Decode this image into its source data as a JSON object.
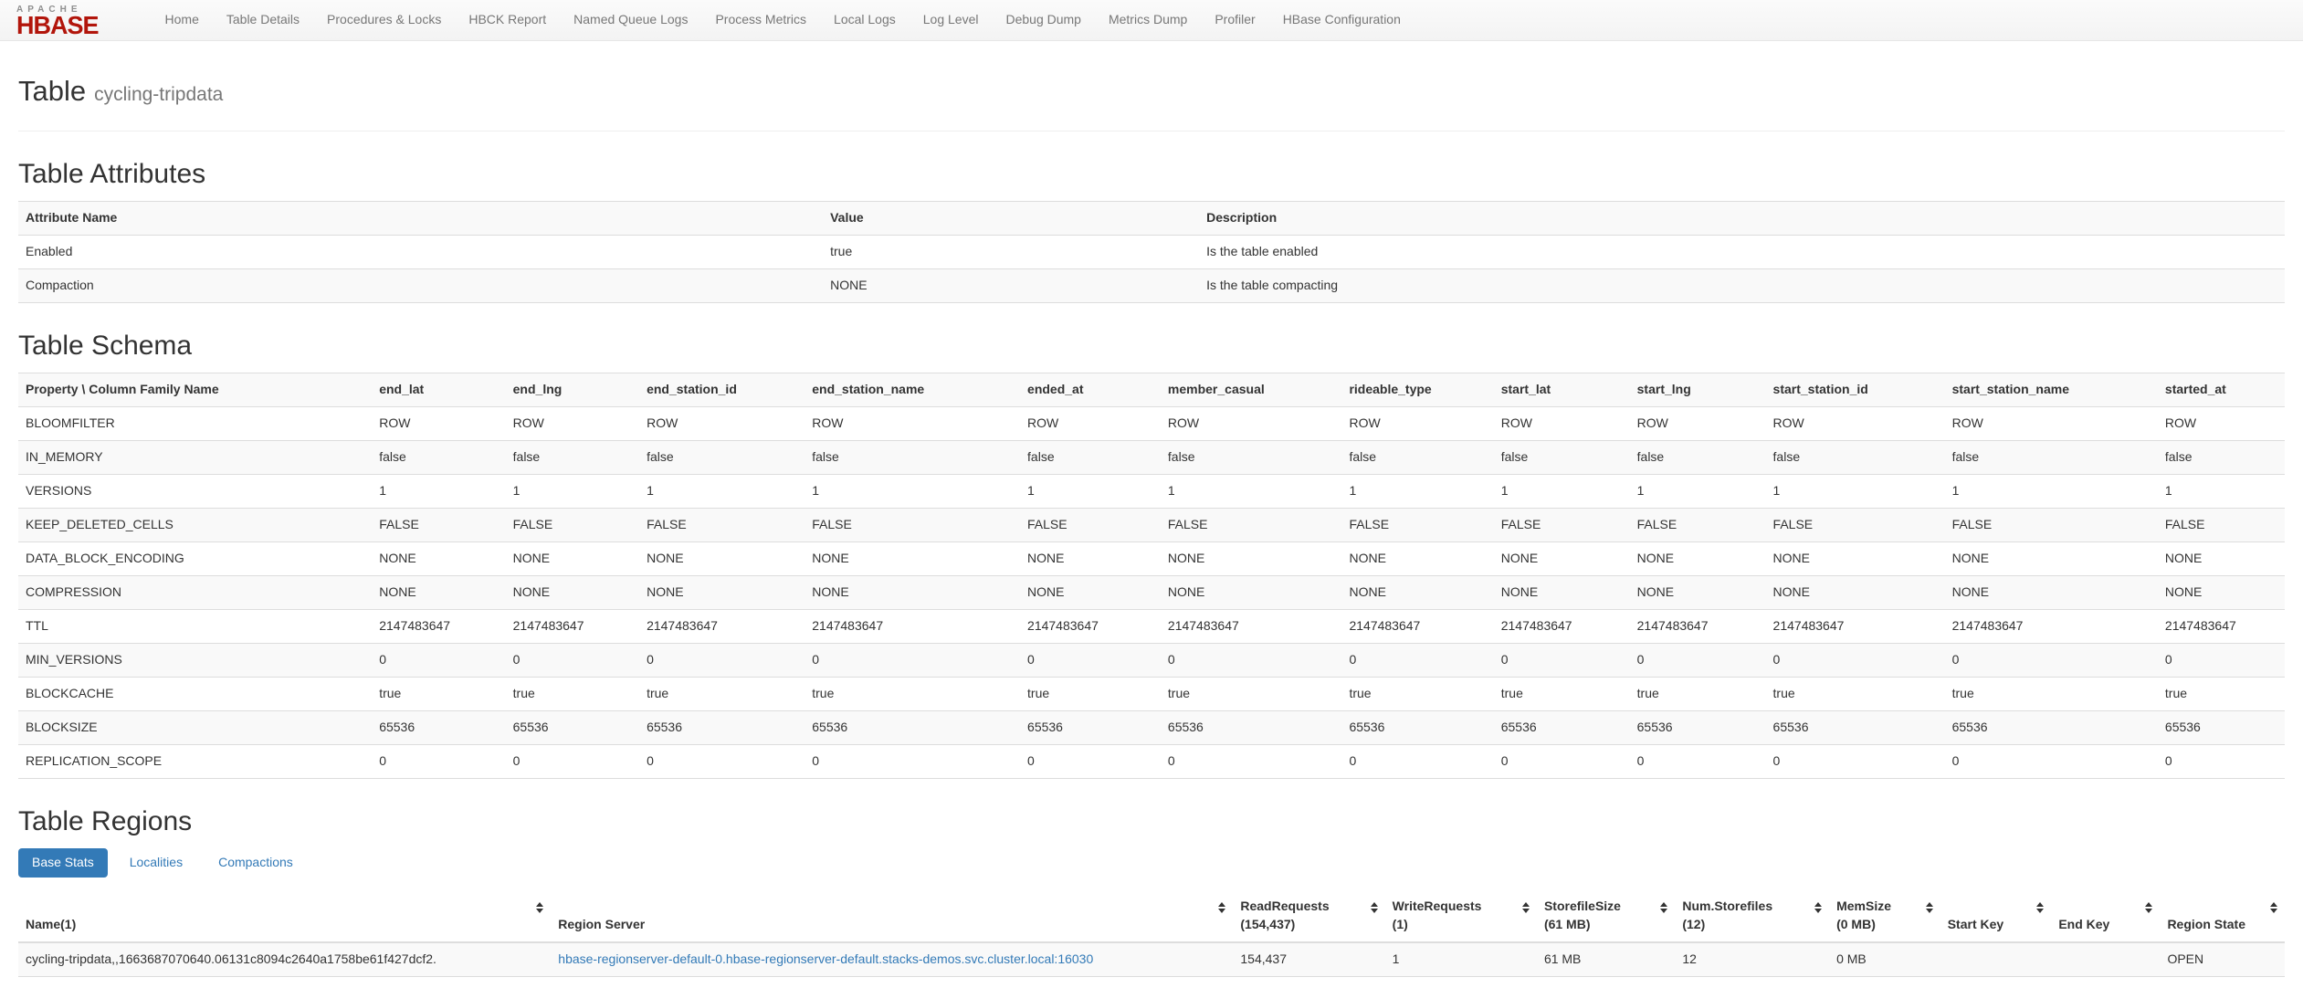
{
  "navbar": {
    "brand_top": "APACHE",
    "brand_main": "HBASE",
    "items": [
      {
        "label": "Home"
      },
      {
        "label": "Table Details"
      },
      {
        "label": "Procedures & Locks"
      },
      {
        "label": "HBCK Report"
      },
      {
        "label": "Named Queue Logs"
      },
      {
        "label": "Process Metrics"
      },
      {
        "label": "Local Logs"
      },
      {
        "label": "Log Level"
      },
      {
        "label": "Debug Dump"
      },
      {
        "label": "Metrics Dump"
      },
      {
        "label": "Profiler"
      },
      {
        "label": "HBase Configuration"
      }
    ]
  },
  "page": {
    "title": "Table",
    "subtitle": "cycling-tripdata"
  },
  "attributes": {
    "heading": "Table Attributes",
    "columns": [
      "Attribute Name",
      "Value",
      "Description"
    ],
    "rows": [
      [
        "Enabled",
        "true",
        "Is the table enabled"
      ],
      [
        "Compaction",
        "NONE",
        "Is the table compacting"
      ]
    ]
  },
  "schema": {
    "heading": "Table Schema",
    "corner_header": "Property \\ Column Family Name",
    "families": [
      "end_lat",
      "end_lng",
      "end_station_id",
      "end_station_name",
      "ended_at",
      "member_casual",
      "rideable_type",
      "start_lat",
      "start_lng",
      "start_station_id",
      "start_station_name",
      "started_at"
    ],
    "properties": [
      {
        "name": "BLOOMFILTER",
        "value": "ROW"
      },
      {
        "name": "IN_MEMORY",
        "value": "false"
      },
      {
        "name": "VERSIONS",
        "value": "1"
      },
      {
        "name": "KEEP_DELETED_CELLS",
        "value": "FALSE"
      },
      {
        "name": "DATA_BLOCK_ENCODING",
        "value": "NONE"
      },
      {
        "name": "COMPRESSION",
        "value": "NONE"
      },
      {
        "name": "TTL",
        "value": "2147483647"
      },
      {
        "name": "MIN_VERSIONS",
        "value": "0"
      },
      {
        "name": "BLOCKCACHE",
        "value": "true"
      },
      {
        "name": "BLOCKSIZE",
        "value": "65536"
      },
      {
        "name": "REPLICATION_SCOPE",
        "value": "0"
      }
    ]
  },
  "regions": {
    "heading": "Table Regions",
    "tabs": [
      {
        "label": "Base Stats",
        "active": true
      },
      {
        "label": "Localities",
        "active": false
      },
      {
        "label": "Compactions",
        "active": false
      }
    ],
    "columns": [
      {
        "label": "Name(1)",
        "sub": ""
      },
      {
        "label": "Region Server",
        "sub": ""
      },
      {
        "label": "ReadRequests",
        "sub": "(154,437)"
      },
      {
        "label": "WriteRequests",
        "sub": "(1)"
      },
      {
        "label": "StorefileSize",
        "sub": "(61 MB)"
      },
      {
        "label": "Num.Storefiles",
        "sub": "(12)"
      },
      {
        "label": "MemSize",
        "sub": "(0 MB)"
      },
      {
        "label": "Start Key",
        "sub": ""
      },
      {
        "label": "End Key",
        "sub": ""
      },
      {
        "label": "Region State",
        "sub": ""
      }
    ],
    "rows": [
      {
        "name": "cycling-tripdata,,1663687070640.06131c8094c2640a1758be61f427dcf2.",
        "region_server": "hbase-regionserver-default-0.hbase-regionserver-default.stacks-demos.svc.cluster.local:16030",
        "read_requests": "154,437",
        "write_requests": "1",
        "storefile_size": "61 MB",
        "num_storefiles": "12",
        "mem_size": "0 MB",
        "start_key": "",
        "end_key": "",
        "region_state": "OPEN"
      }
    ]
  },
  "colors": {
    "accent": "#337ab7",
    "brand_red": "#b2150b",
    "link_blue": "#337ab7",
    "stripe": "#f9f9f9"
  }
}
